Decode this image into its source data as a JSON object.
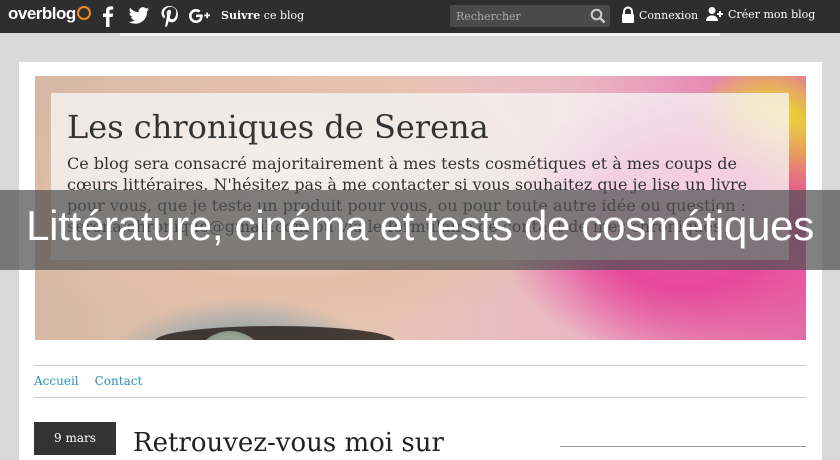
{
  "topbar": {
    "logo_over": "over",
    "logo_blog": "blog",
    "suivre_bold": "Suivre",
    "suivre_rest": " ce blog",
    "search_placeholder": "Rechercher",
    "connexion_label": "Connexion",
    "creer_label": "Créer mon blog"
  },
  "blog": {
    "title": "Les chroniques de Serena",
    "description": "Ce blog sera consacré majoritairement à mes tests cosmétiques et à mes coups de cœurs littéraires. N'hésitez pas à me contacter si vous souhaitez que je lise un livre pour vous, que je teste un produit pour vous, ou pour toute autre idée ou question : serena.chronique@gmail.com ou via le formulaire de contact de mes chroniques !"
  },
  "overlay": {
    "tagline": "Littérature, cinéma et tests de cosmétiques"
  },
  "nav": {
    "items": [
      {
        "label": "Accueil"
      },
      {
        "label": "Contact"
      }
    ]
  },
  "post": {
    "date": "9 mars",
    "title": "Retrouvez-vous moi sur"
  },
  "colors": {
    "topbar": "#2e2e2e",
    "link": "#2a8fbd",
    "logo_accent": "#f08a24"
  }
}
